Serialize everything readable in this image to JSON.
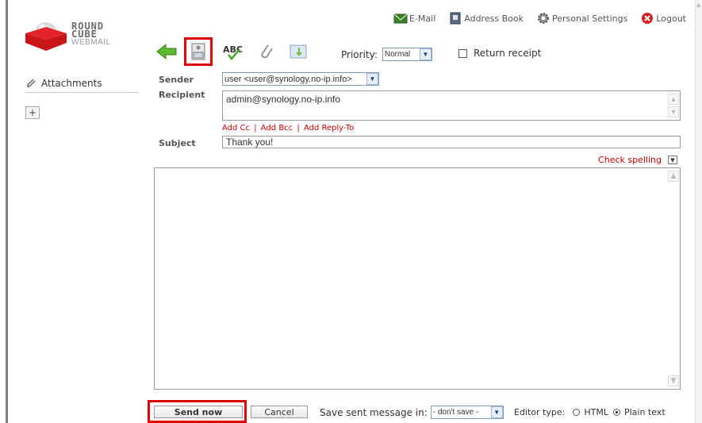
{
  "logo": {
    "line1": "ROUND",
    "line2": "CUBE",
    "line3": "WEBMAIL"
  },
  "topnav": {
    "email": "E-Mail",
    "address_book": "Address Book",
    "personal_settings": "Personal Settings",
    "logout": "Logout"
  },
  "toolbar": {
    "priority_label": "Priority:",
    "priority_value": "Normal",
    "return_receipt": "Return receipt"
  },
  "sidebar": {
    "attachments_label": "Attachments",
    "add_label": "+"
  },
  "form": {
    "sender_label": "Sender",
    "sender_value": "user <user@synology.no-ip.info>",
    "recipient_label": "Recipient",
    "recipient_value": "admin@synology.no-ip.info",
    "add_cc": "Add Cc",
    "add_bcc": "Add Bcc",
    "add_reply_to": "Add Reply-To",
    "separator": "|",
    "subject_label": "Subject",
    "subject_value": "Thank you!",
    "check_spelling": "Check spelling"
  },
  "footer": {
    "send_now": "Send now",
    "cancel": "Cancel",
    "save_sent_label": "Save sent message in:",
    "save_sent_value": "- don't save -",
    "editor_type_label": "Editor type:",
    "editor_html": "HTML",
    "editor_plain": "Plain text",
    "editor_selected": "Plain text"
  },
  "colors": {
    "accent_red": "#e00000",
    "link_red": "#cc0000"
  }
}
